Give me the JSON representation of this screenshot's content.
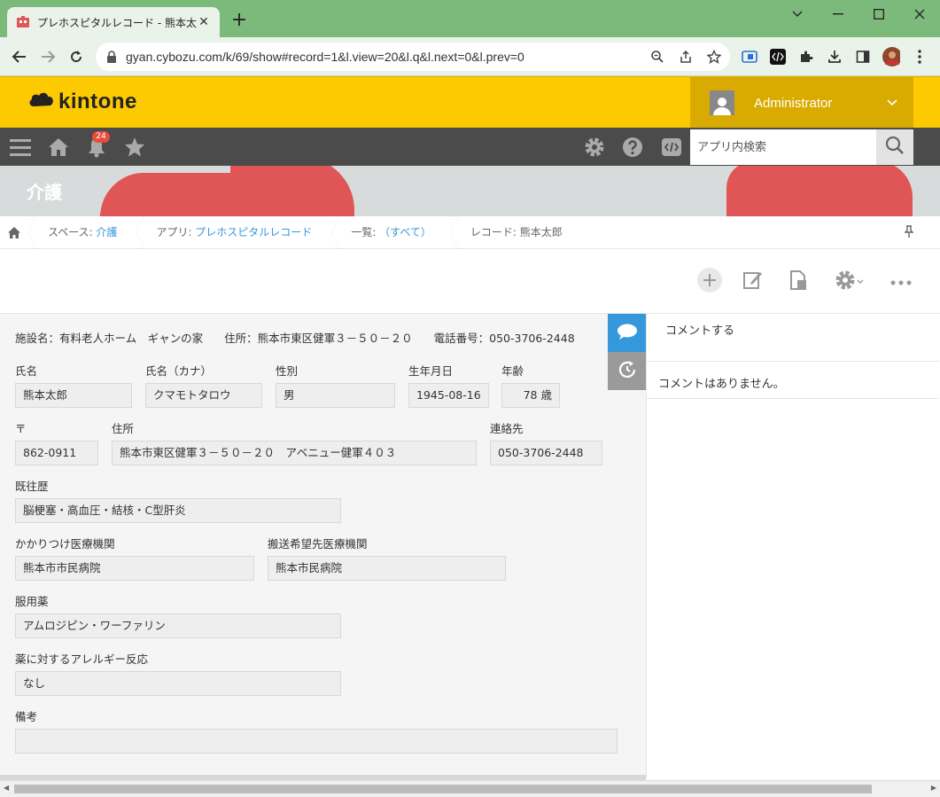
{
  "browser": {
    "tab_title": "プレホスピタルレコード - 熊本太郎 - k",
    "url": "gyan.cybozu.com/k/69/show#record=1&l.view=20&l.q&l.next=0&l.prev=0"
  },
  "header": {
    "logo_text": "kintone",
    "user_name": "Administrator",
    "notification_count": "24",
    "search_placeholder": "アプリ内検索"
  },
  "space": {
    "title": "介護"
  },
  "breadcrumb": {
    "space_label": "スペース: ",
    "space_value": "介護",
    "app_label": "アプリ: ",
    "app_value": "プレホスピタルレコード",
    "view_label": "一覧: ",
    "view_value": "（すべて）",
    "record_label": "レコード: 熊本太郎"
  },
  "record": {
    "facility_name": "施設名：有料老人ホーム　ギャンの家",
    "facility_address": "住所：熊本市東区健軍３－５０－２０",
    "facility_phone": "電話番号：050-3706-2448",
    "fields": {
      "name_label": "氏名",
      "name_value": "熊本太郎",
      "kana_label": "氏名（カナ）",
      "kana_value": "クマモトタロウ",
      "gender_label": "性別",
      "gender_value": "男",
      "birth_label": "生年月日",
      "birth_value": "1945-08-16",
      "age_label": "年齢",
      "age_value": "78 歳",
      "zip_label": "〒",
      "zip_value": "862-0911",
      "address_label": "住所",
      "address_value": "熊本市東区健軍３－５０－２０　アベニュー健軍４０３",
      "contact_label": "連絡先",
      "contact_value": "050-3706-2448",
      "history_label": "既往歴",
      "history_value": "脳梗塞・高血圧・結核・C型肝炎",
      "clinic_label": "かかりつけ医療機関",
      "clinic_value": "熊本市市民病院",
      "transport_label": "搬送希望先医療機関",
      "transport_value": "熊本市民病院",
      "meds_label": "服用薬",
      "meds_value": "アムロジピン・ワーファリン",
      "allergy_label": "薬に対するアレルギー反応",
      "allergy_value": "なし",
      "notes_label": "備考",
      "notes_value": ""
    }
  },
  "comments": {
    "post_label": "コメントする",
    "empty_label": "コメントはありません。"
  },
  "colors": {
    "kintone_yellow": "#fdc900",
    "user_area": "#d9ab00",
    "nav_dark": "#4b4b4b",
    "link_blue": "#3498db",
    "sidetab_blue": "#3498db"
  }
}
